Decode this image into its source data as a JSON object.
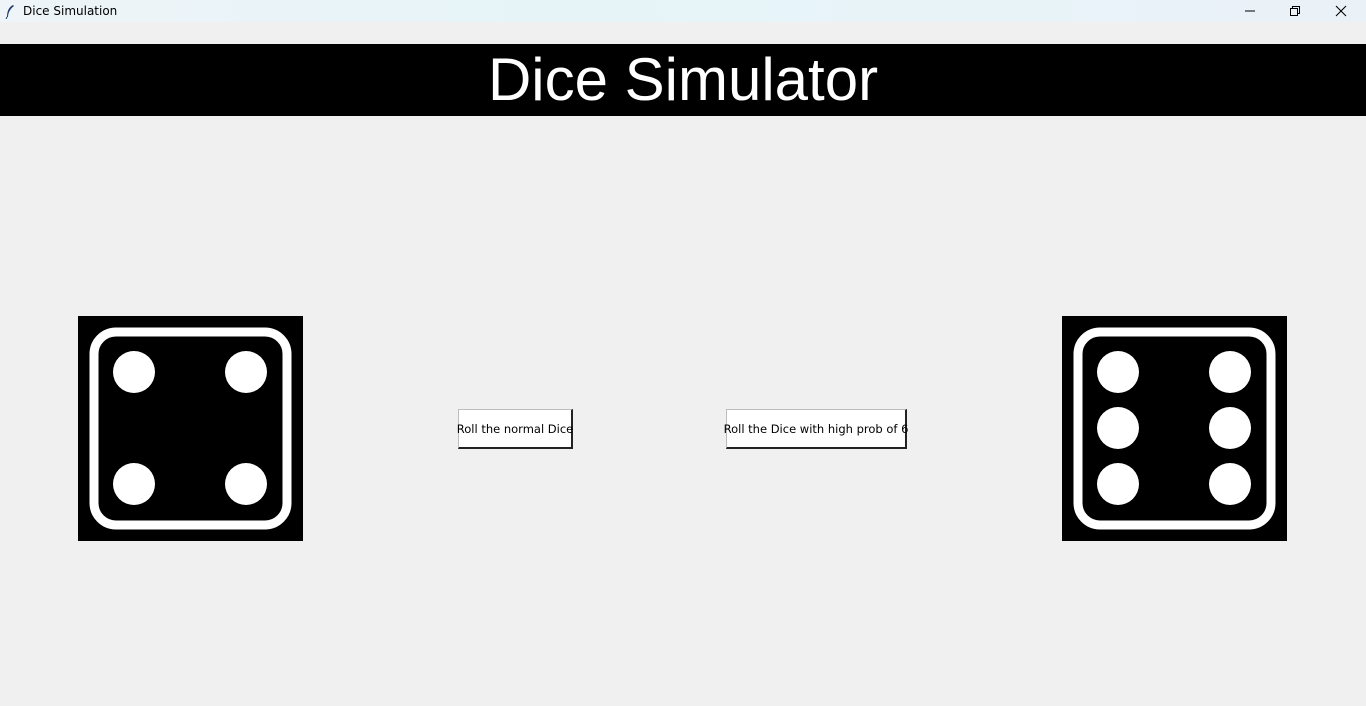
{
  "window": {
    "title": "Dice Simulation",
    "icon": "feather-icon",
    "controls": [
      "minimize-icon",
      "restore-icon",
      "close-icon"
    ]
  },
  "header": {
    "title": "Dice Simulator",
    "background": "#000000",
    "color": "#ffffff"
  },
  "dice": {
    "left": {
      "value": 4,
      "icon": "dice-four-icon"
    },
    "right": {
      "value": 6,
      "icon": "dice-six-icon"
    }
  },
  "buttons": {
    "roll_normal": "Roll the normal Dice",
    "roll_high": "Roll the Dice with high prob of 6"
  }
}
